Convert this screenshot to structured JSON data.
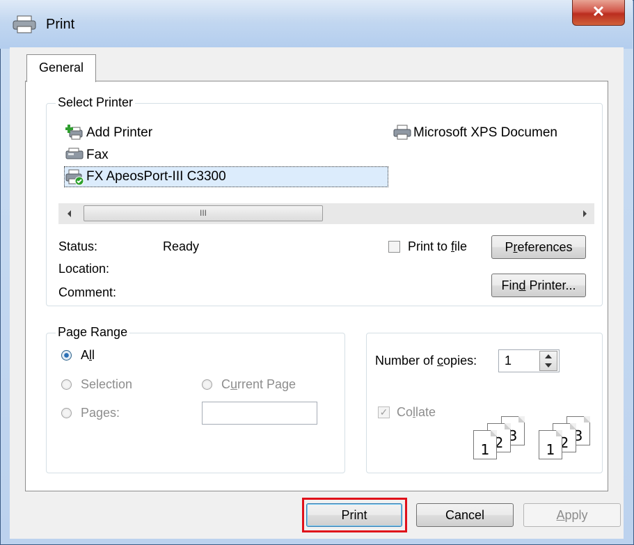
{
  "window": {
    "title": "Print",
    "close_glyph": "✕"
  },
  "tabs": [
    {
      "label": "General"
    }
  ],
  "select_printer": {
    "legend": "Select Printer",
    "printers": [
      {
        "name": "Add Printer",
        "icon": "add-printer-icon"
      },
      {
        "name": "Microsoft XPS Documen",
        "icon": "printer-icon"
      },
      {
        "name": "Fax",
        "icon": "fax-icon"
      },
      {
        "name": "FX ApeosPort-III C3300",
        "icon": "default-printer-icon",
        "selected": true
      }
    ],
    "scroll_grip": "III",
    "status_label": "Status:",
    "status_value": "Ready",
    "location_label": "Location:",
    "location_value": "",
    "comment_label": "Comment:",
    "comment_value": "",
    "print_to_file": {
      "before": "Print to ",
      "accel": "f",
      "after": "ile",
      "checked": false
    },
    "preferences": {
      "before": "P",
      "accel": "r",
      "after": "eferences"
    },
    "find_printer": {
      "before": "Fin",
      "accel": "d",
      "after": " Printer..."
    }
  },
  "page_range": {
    "legend": "Page Range",
    "all": {
      "before": "A",
      "accel": "l",
      "after": "l",
      "selected": true
    },
    "selection": {
      "label": "Selection",
      "enabled": false
    },
    "current_page": {
      "before": "C",
      "accel": "u",
      "after": "rrent Page",
      "enabled": false
    },
    "pages": {
      "before": "Pa",
      "accel": "g",
      "after": "es:",
      "enabled": false,
      "value": ""
    }
  },
  "copies": {
    "label_before": "Number of ",
    "label_accel": "c",
    "label_after": "opies:",
    "value": "1",
    "collate": {
      "before": "Co",
      "accel": "l",
      "after": "late",
      "checked": true,
      "enabled": false
    },
    "page_numbers": [
      "1",
      "2",
      "3"
    ]
  },
  "buttons": {
    "print": "Print",
    "cancel": "Cancel",
    "apply_accel": "A",
    "apply_after": "pply"
  },
  "colors": {
    "highlight": "#e0101a",
    "selection_bg": "#dcecfc"
  }
}
